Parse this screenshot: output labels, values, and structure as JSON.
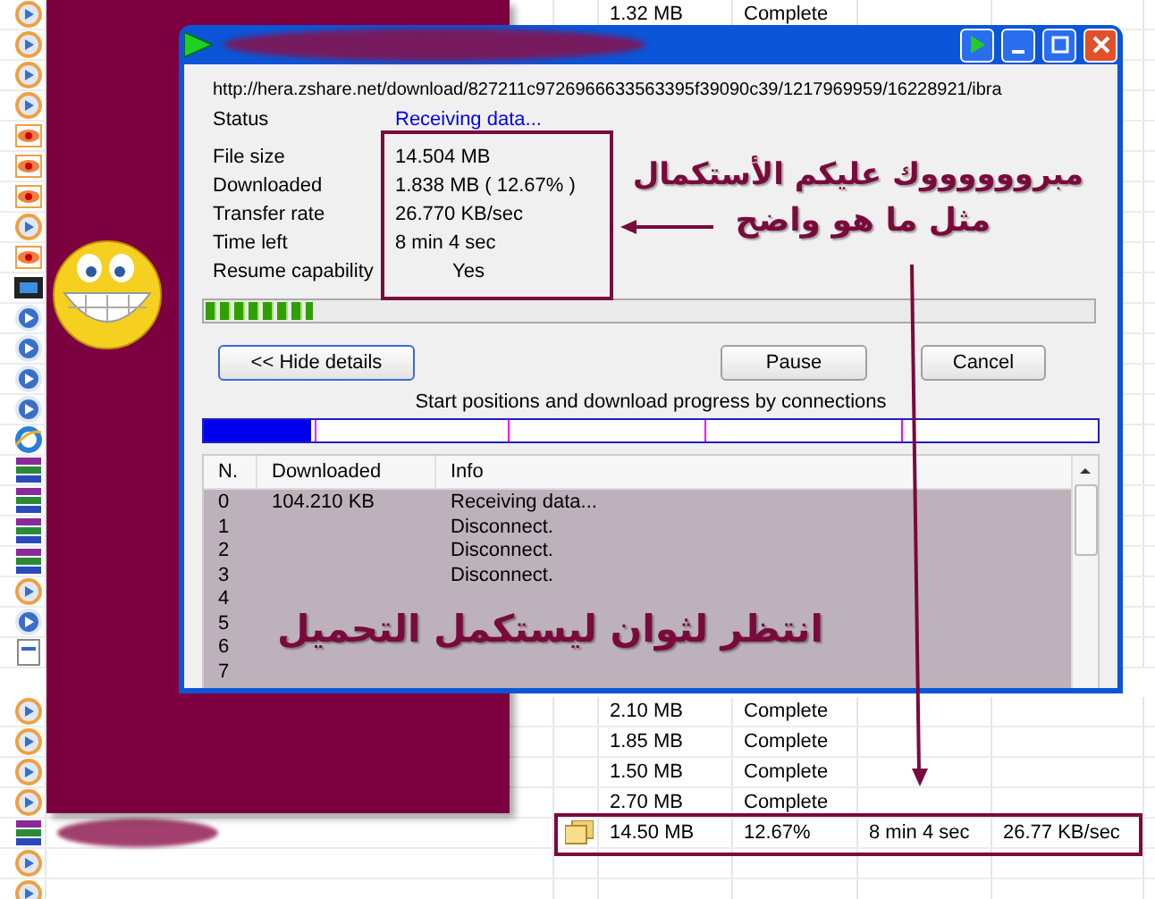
{
  "file_list": {
    "top_rows": [
      {
        "size": "1.32  MB",
        "status": "Complete"
      }
    ],
    "bottom_rows": [
      {
        "size": "2.10  MB",
        "status": "Complete"
      },
      {
        "size": "1.85  MB",
        "status": "Complete"
      },
      {
        "size": "1.50  MB",
        "status": "Complete"
      },
      {
        "size": "2.70  MB",
        "status": "Complete"
      }
    ],
    "active_row": {
      "size": "14.50  MB",
      "percent": "12.67%",
      "time_left": "8 min 4 sec",
      "rate": "26.77  KB/sec"
    }
  },
  "download_dialog": {
    "url": "http://hera.zshare.net/download/827211c9726966633563395f39090c39/1217969959/16228921/ibra",
    "status_label": "Status",
    "status": "Receiving data...",
    "details": [
      {
        "label": "File size",
        "value": "14.504  MB"
      },
      {
        "label": "Downloaded",
        "value": "1.838  MB  ( 12.67% )"
      },
      {
        "label": "Transfer rate",
        "value": "26.770  KB/sec"
      },
      {
        "label": "Time left",
        "value": "8 min 4 sec"
      },
      {
        "label": "Resume capability",
        "value": "Yes"
      }
    ],
    "progress": {
      "level": 0.12
    },
    "buttons": [
      {
        "label": "<< Hide details"
      },
      {
        "label": "Pause"
      },
      {
        "label": "Cancel"
      }
    ],
    "connections_caption": "Start positions and download progress by connections",
    "connection_bar": {
      "level": 0.12
    },
    "table": {
      "columns": [
        "N.",
        "Downloaded",
        "Info"
      ],
      "rows": [
        {
          "n": "0",
          "downloaded": "104.210  KB",
          "info": "Receiving data..."
        },
        {
          "n": "1",
          "downloaded": "",
          "info": "Disconnect."
        },
        {
          "n": "2",
          "downloaded": "",
          "info": "Disconnect."
        },
        {
          "n": "3",
          "downloaded": "",
          "info": "Disconnect."
        },
        {
          "n": "4",
          "downloaded": "",
          "info": ""
        },
        {
          "n": "5",
          "downloaded": "",
          "info": ""
        },
        {
          "n": "6",
          "downloaded": "",
          "info": ""
        },
        {
          "n": "7",
          "downloaded": "",
          "info": ""
        }
      ]
    }
  },
  "annotations": {
    "headline": "مبرووووووك عليكم الأستكمال",
    "subline": "مثل ما هو واضح",
    "wait_note": "انتظر لثوان ليستكمل التحميل"
  }
}
